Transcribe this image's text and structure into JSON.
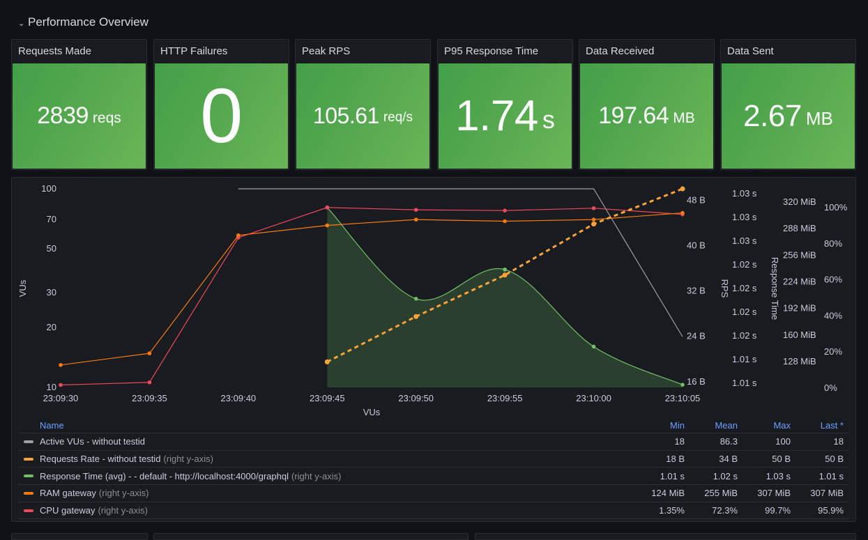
{
  "row": {
    "title": "Performance Overview",
    "collapse_icon": "chevron-down-icon"
  },
  "stats": [
    {
      "title": "Requests Made",
      "value": "2839",
      "unit": "reqs",
      "color": "#56a64b"
    },
    {
      "title": "HTTP Failures",
      "value": "0",
      "unit": "",
      "color": "#56a64b"
    },
    {
      "title": "Peak RPS",
      "value": "105.61",
      "unit": "req/s",
      "color": "#56a64b"
    },
    {
      "title": "P95 Response Time",
      "value": "1.74",
      "unit": "s",
      "color": "#56a64b"
    },
    {
      "title": "Data Received",
      "value": "197.64",
      "unit": "MB",
      "color": "#56a64b"
    },
    {
      "title": "Data Sent",
      "value": "2.67",
      "unit": "MB",
      "color": "#56a64b"
    }
  ],
  "chart_data": {
    "type": "line",
    "title": "",
    "xlabel": "VUs",
    "x": [
      "23:09:30",
      "23:09:35",
      "23:09:40",
      "23:09:45",
      "23:09:50",
      "23:09:55",
      "23:10:00",
      "23:10:05"
    ],
    "x_ticks": [
      "23:09:30",
      "23:09:35",
      "23:09:40",
      "23:09:45",
      "23:09:50",
      "23:09:55",
      "23:10:00",
      "23:10:05"
    ],
    "axes": {
      "left": {
        "label": "VUs",
        "scale": "log",
        "ticks": [
          "100",
          "70",
          "50",
          "30",
          "20",
          "10"
        ],
        "tick_values": [
          100,
          70,
          50,
          30,
          20,
          10
        ],
        "range": [
          10,
          100
        ]
      },
      "rps": {
        "label": "RPS",
        "ticks": [
          "48 B",
          "40 B",
          "32 B",
          "24 B",
          "16 B"
        ],
        "tick_values": [
          48,
          40,
          32,
          24,
          16
        ],
        "range": [
          15,
          50
        ]
      },
      "response": {
        "label": "Response Time",
        "ticks": [
          "1.03 s",
          "1.03 s",
          "1.03 s",
          "1.02 s",
          "1.02 s",
          "1.02 s",
          "1.02 s",
          "1.01 s",
          "1.01 s"
        ],
        "range": [
          1.0088,
          1.0312
        ]
      },
      "ram": {
        "label": "",
        "ticks": [
          "320 MiB",
          "288 MiB",
          "256 MiB",
          "224 MiB",
          "192 MiB",
          "160 MiB",
          "128 MiB"
        ],
        "tick_values": [
          320,
          288,
          256,
          224,
          192,
          160,
          128
        ],
        "range": [
          97,
          336
        ]
      },
      "cpu": {
        "label": "",
        "ticks": [
          "100%",
          "80%",
          "60%",
          "40%",
          "20%",
          "0%"
        ],
        "tick_values": [
          100,
          80,
          60,
          40,
          20,
          0
        ],
        "range": [
          0,
          100
        ]
      }
    },
    "series": [
      {
        "name": "Active VUs - without testid",
        "axis": "left",
        "color": "#9fa0a6",
        "style": "line",
        "points": false,
        "values": [
          null,
          null,
          100,
          100,
          100,
          100,
          100,
          18
        ]
      },
      {
        "name": "Requests Rate - without testid",
        "axis": "rps",
        "color": "#ffa33a",
        "style": "dashed",
        "points": true,
        "values": [
          null,
          null,
          null,
          19.5,
          27.5,
          34.8,
          43.8,
          50
        ]
      },
      {
        "name": "Response Time (avg) - - default - http://localhost:4000/graphql",
        "axis": "response",
        "color": "#73bf69",
        "style": "smooth-area",
        "points": true,
        "values": [
          null,
          null,
          null,
          1.0291,
          1.0188,
          1.0221,
          1.0134,
          1.0091
        ]
      },
      {
        "name": "RAM gateway",
        "axis": "ram",
        "color": "#ff7b0f",
        "style": "line",
        "points": true,
        "values": [
          124,
          138,
          280,
          292,
          299,
          297,
          299,
          307
        ]
      },
      {
        "name": "CPU gateway",
        "axis": "cpu",
        "color": "#f2495c",
        "style": "line",
        "points": true,
        "values": [
          1.35,
          2.8,
          83,
          99.7,
          98.4,
          98,
          99.3,
          95.9
        ]
      }
    ],
    "legend_placement": "bottom",
    "grid": false
  },
  "legend": {
    "headers": {
      "name": "Name",
      "min": "Min",
      "mean": "Mean",
      "max": "Max",
      "last": "Last *"
    },
    "note": "(right y-axis)",
    "rows": [
      {
        "name": "Active VUs - without testid",
        "right_axis": false,
        "color": "#9fa0a6",
        "min": "18",
        "mean": "86.3",
        "max": "100",
        "last": "18"
      },
      {
        "name": "Requests Rate - without testid",
        "right_axis": true,
        "color": "#ffa33a",
        "min": "18 B",
        "mean": "34 B",
        "max": "50 B",
        "last": "50 B"
      },
      {
        "name": "Response Time (avg) - - default - http://localhost:4000/graphql",
        "right_axis": true,
        "color": "#73bf69",
        "min": "1.01 s",
        "mean": "1.02 s",
        "max": "1.03 s",
        "last": "1.01 s"
      },
      {
        "name": "RAM gateway",
        "right_axis": true,
        "color": "#ff7b0f",
        "min": "124 MiB",
        "mean": "255 MiB",
        "max": "307 MiB",
        "last": "307 MiB"
      },
      {
        "name": "CPU gateway",
        "right_axis": true,
        "color": "#f2495c",
        "min": "1.35%",
        "mean": "72.3%",
        "max": "99.7%",
        "last": "95.9%"
      }
    ]
  }
}
